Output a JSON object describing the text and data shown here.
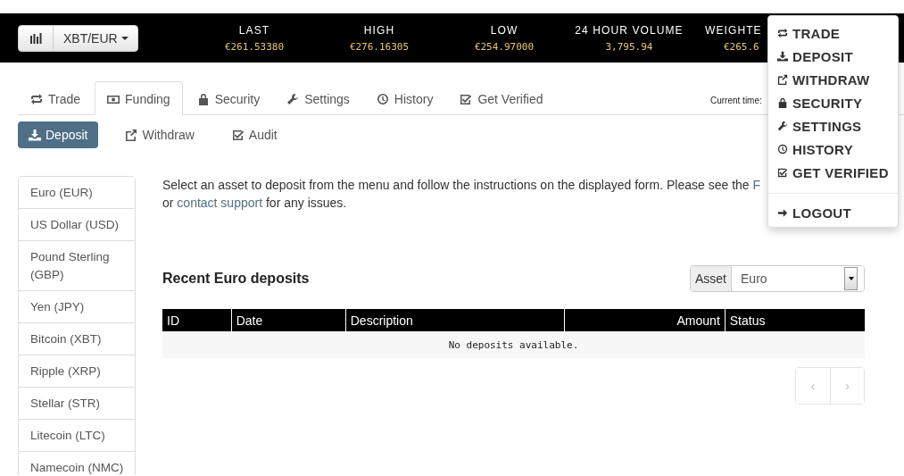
{
  "pair_selector": {
    "label": "XBT/EUR"
  },
  "ticker": [
    {
      "label": "LAST",
      "value": "€261.53380"
    },
    {
      "label": "HIGH",
      "value": "€276.16305"
    },
    {
      "label": "LOW",
      "value": "€254.97000"
    },
    {
      "label": "24 HOUR VOLUME",
      "value": "3,795.94"
    },
    {
      "label": "WEIGHTE",
      "value": "€265.6"
    }
  ],
  "tabs": [
    {
      "label": "Trade",
      "selected": false
    },
    {
      "label": "Funding",
      "selected": true
    },
    {
      "label": "Security",
      "selected": false
    },
    {
      "label": "Settings",
      "selected": false
    },
    {
      "label": "History",
      "selected": false
    },
    {
      "label": "Get Verified",
      "selected": false
    }
  ],
  "current_time": "Current time:",
  "subnav": [
    {
      "label": "Deposit",
      "selected": true
    },
    {
      "label": "Withdraw",
      "selected": false
    },
    {
      "label": "Audit",
      "selected": false
    }
  ],
  "assets": [
    {
      "label": "Euro (EUR)",
      "selected": false
    },
    {
      "label": "US Dollar (USD)",
      "selected": false
    },
    {
      "label": "Pound Sterling (GBP)",
      "selected": false
    },
    {
      "label": "Yen (JPY)",
      "selected": false
    },
    {
      "label": "Bitcoin (XBT)",
      "selected": false
    },
    {
      "label": "Ripple (XRP)",
      "selected": false
    },
    {
      "label": "Stellar (STR)",
      "selected": false
    },
    {
      "label": "Litecoin (LTC)",
      "selected": false
    },
    {
      "label": "Namecoin (NMC)",
      "selected": false
    }
  ],
  "intro": [
    [
      {
        "text": "Select an asset to deposit from the menu and follow the instructions on the displayed form. Please see the ",
        "kind": "text"
      },
      {
        "text": "F",
        "kind": "link"
      }
    ],
    [
      {
        "text": "or ",
        "kind": "text"
      },
      {
        "text": "contact support",
        "kind": "link"
      },
      {
        "text": " for any issues.",
        "kind": "text"
      }
    ]
  ],
  "deposits": {
    "title": "Recent Euro deposits",
    "asset_select": {
      "label": "Asset",
      "value": "Euro"
    },
    "columns": [
      "ID",
      "Date",
      "Description",
      "Amount",
      "Status"
    ],
    "empty_message": "No deposits available.",
    "pagination": {
      "prev": "‹",
      "next": "›"
    }
  },
  "account_menu": {
    "items": [
      "TRADE",
      "DEPOSIT",
      "WITHDRAW",
      "SECURITY",
      "SETTINGS",
      "HISTORY",
      "GET VERIFIED"
    ],
    "logout": "LOGOUT"
  }
}
